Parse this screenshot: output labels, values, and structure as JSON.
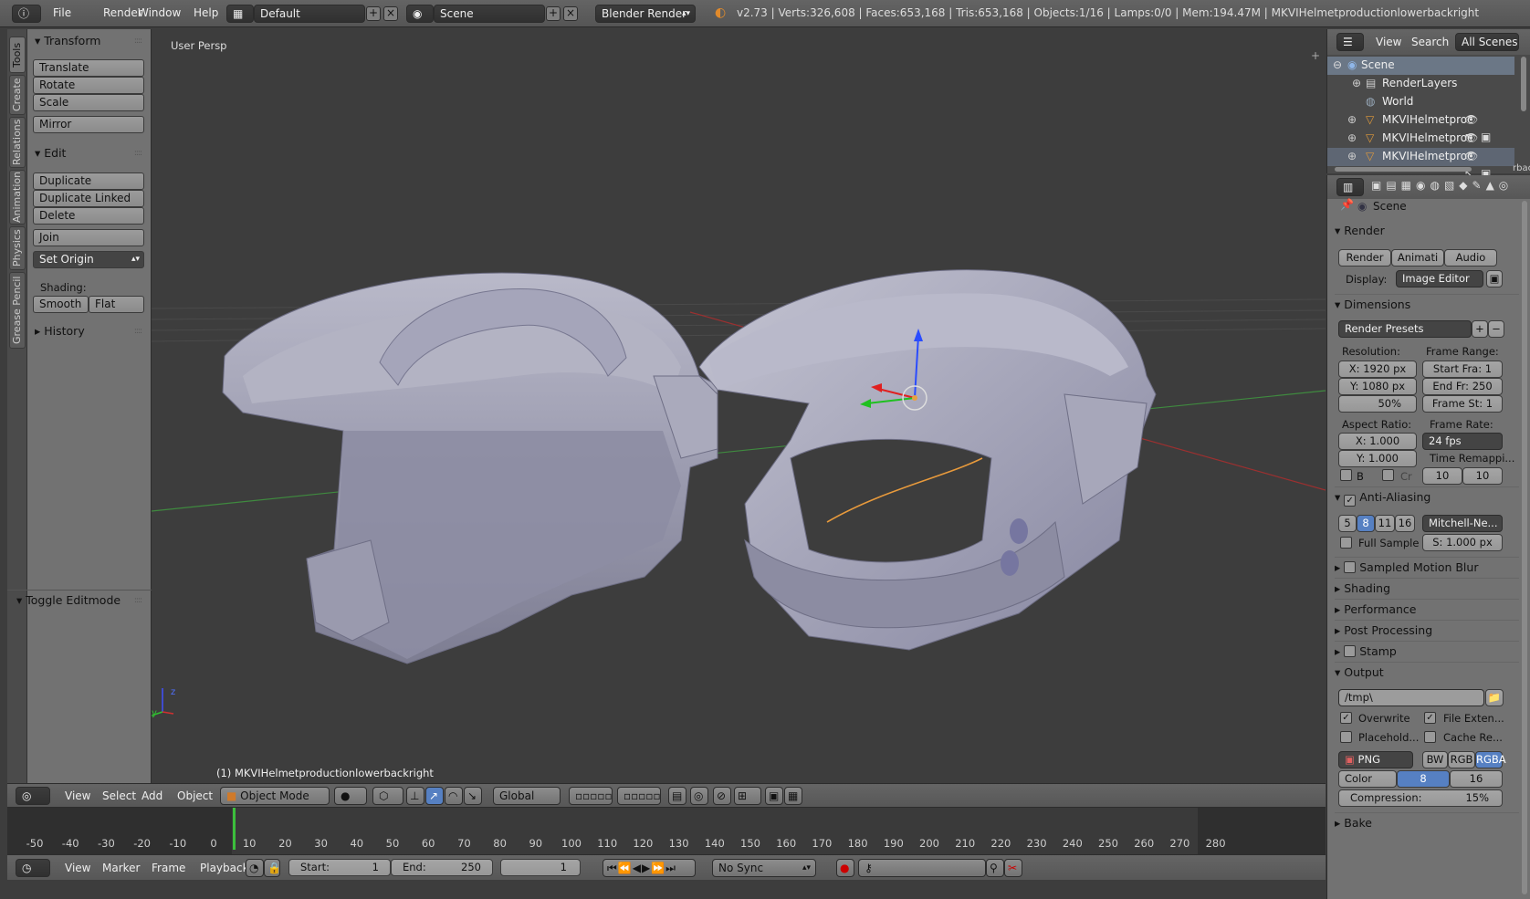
{
  "top": {
    "menus": [
      "File",
      "Render",
      "Window",
      "Help"
    ],
    "layout": "Default",
    "scene": "Scene",
    "engine": "Blender Render",
    "stats": "v2.73 | Verts:326,608 | Faces:653,168 | Tris:653,168 | Objects:1/16 | Lamps:0/0 | Mem:194.47M | MKVIHelmetproductionlowerbackright"
  },
  "tabs": [
    "Tools",
    "Create",
    "Relations",
    "Animation",
    "Physics",
    "Grease Pencil"
  ],
  "toolshelf": {
    "transform_title": "Transform",
    "transform_buttons": [
      "Translate",
      "Rotate",
      "Scale"
    ],
    "mirror": "Mirror",
    "edit_title": "Edit",
    "edit_buttons": [
      "Duplicate",
      "Duplicate Linked",
      "Delete"
    ],
    "join": "Join",
    "set_origin": "Set Origin",
    "shading_label": "Shading:",
    "smooth": "Smooth",
    "flat": "Flat",
    "history": "History",
    "toggle_editmode": "Toggle Editmode"
  },
  "viewport": {
    "view_label": "User Persp",
    "object_label": "(1) MKVIHelmetproductionlowerbackright",
    "axis_z": "z",
    "axis_y": "y"
  },
  "viewport_header": {
    "menus": [
      "View",
      "Select",
      "Add",
      "Object"
    ],
    "mode": "Object Mode",
    "orientation": "Global"
  },
  "timeline": {
    "ticks": [
      "-50",
      "-40",
      "-30",
      "-20",
      "-10",
      "0",
      "10",
      "20",
      "30",
      "40",
      "50",
      "60",
      "70",
      "80",
      "90",
      "100",
      "110",
      "120",
      "130",
      "140",
      "150",
      "160",
      "170",
      "180",
      "190",
      "200",
      "210",
      "220",
      "230",
      "240",
      "250",
      "260",
      "270",
      "280"
    ],
    "current_frame_value": 1,
    "menus": [
      "View",
      "Marker",
      "Frame",
      "Playback"
    ],
    "start_label": "Start:",
    "start_value": "1",
    "end_label": "End:",
    "end_value": "250",
    "current": "1",
    "sync": "No Sync"
  },
  "outliner": {
    "menus": [
      "View",
      "Search"
    ],
    "filter": "All Scenes",
    "rows": [
      "Scene",
      "RenderLayers",
      "World",
      "MKVIHelmetproc",
      "MKVIHelmetproc",
      "MKVIHelmetproc"
    ],
    "cut_text": "rbac"
  },
  "properties": {
    "context": "Scene",
    "render_title": "Render",
    "render_buttons": [
      "Render",
      "Animati",
      "Audio"
    ],
    "display_label": "Display:",
    "display_value": "Image Editor",
    "dimensions_title": "Dimensions",
    "presets": "Render Presets",
    "resolution_label": "Resolution:",
    "res_x": "X: 1920 px",
    "res_y": "Y: 1080 px",
    "res_pct": "50%",
    "frame_range_label": "Frame Range:",
    "start_fra": "Start Fra:  1",
    "end_fr": "End Fr: 250",
    "frame_st": "Frame St: 1",
    "aspect_label": "Aspect Ratio:",
    "asp_x": "X:   1.000",
    "asp_y": "Y:   1.000",
    "frame_rate_label": "Frame Rate:",
    "fps": "24 fps",
    "time_remap_label": "Time Remappi...",
    "remap_old": "10",
    "remap_new": "10",
    "b_label": "B",
    "cr_label": "Cr",
    "aa_title": "Anti-Aliasing",
    "aa_samples": [
      "5",
      "8",
      "11",
      "16"
    ],
    "aa_filter": "Mitchell-Ne...",
    "full_sample": "Full Sample",
    "filter_size": "S: 1.000 px",
    "collapsed": [
      "Sampled Motion Blur",
      "Shading",
      "Performance",
      "Post Processing",
      "Stamp"
    ],
    "output_title": "Output",
    "output_path": "/tmp\\",
    "overwrite": "Overwrite",
    "file_ext": "File Exten...",
    "placeholders": "Placehold...",
    "cache_result": "Cache Re...",
    "format": "PNG",
    "color_modes": [
      "BW",
      "RGB",
      "RGBA"
    ],
    "color_depth_label": "Color Dep",
    "depths": [
      "8",
      "16"
    ],
    "compression": "Compression:",
    "compression_value": "15%",
    "bake_title": "Bake"
  },
  "colors": {
    "accent_blue": "#5680c2",
    "panel_gray": "#727272",
    "viewport_bg": "#3d3d3d"
  }
}
